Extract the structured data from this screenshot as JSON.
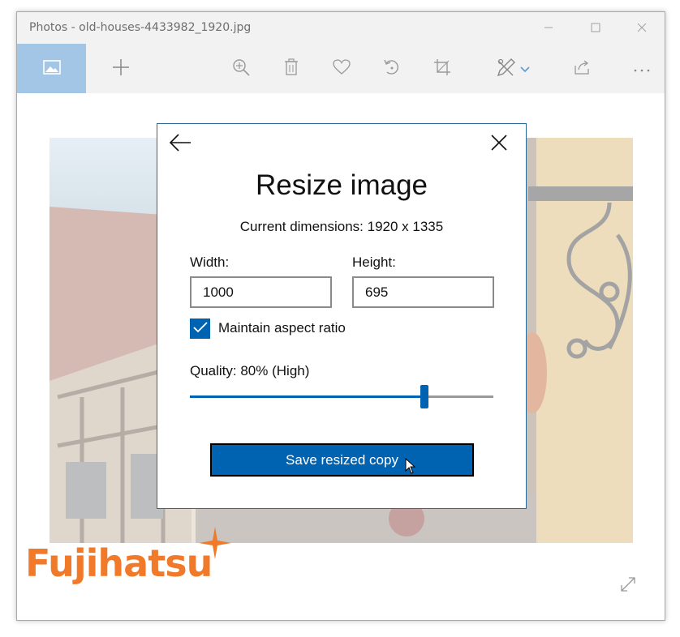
{
  "window": {
    "title": "Photos - old-houses-4433982_1920.jpg"
  },
  "toolbar": {
    "items": [
      "photo-icon",
      "add-icon",
      "zoom-icon",
      "delete-icon",
      "favorite-icon",
      "rotate-icon",
      "crop-icon",
      "edit-draw-icon",
      "share-icon",
      "more-icon"
    ]
  },
  "dialog": {
    "title": "Resize image",
    "current_dimensions": "Current dimensions: 1920 x 1335",
    "width_label": "Width:",
    "width_value": "1000",
    "height_label": "Height:",
    "height_value": "695",
    "aspect_label": "Maintain aspect ratio",
    "aspect_checked": true,
    "quality_label": "Quality: 80% (High)",
    "quality_value": 80,
    "save_label": "Save resized copy"
  },
  "brand": {
    "name": "Fujihatsu"
  },
  "colors": {
    "accent": "#0063b1",
    "selected_tab": "#a3c6e6",
    "brand": "#f07a2a"
  }
}
